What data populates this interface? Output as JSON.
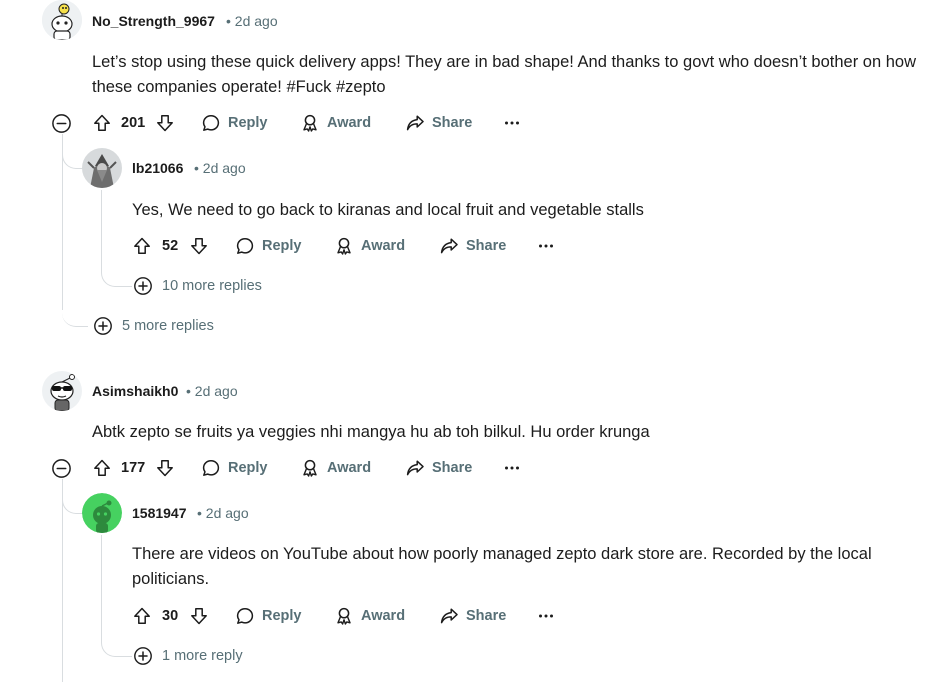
{
  "comments": [
    {
      "username": "No_Strength_9967",
      "age": "2d ago",
      "body": "Let’s stop using these quick delivery apps! They are in bad shape! And thanks to govt who doesn’t bother on how these companies operate! #Fuck #zepto",
      "votes": "201",
      "reply_label": "Reply",
      "award_label": "Award",
      "share_label": "Share",
      "more_label": "•••",
      "replies": [
        {
          "username": "lb21066",
          "age": "2d ago",
          "body": "Yes, We need to go back to kiranas and local fruit and vegetable stalls",
          "votes": "52",
          "reply_label": "Reply",
          "award_label": "Award",
          "share_label": "Share",
          "more_label": "•••",
          "more_replies": "10 more replies"
        }
      ],
      "more_replies": "5 more replies"
    },
    {
      "username": "Asimshaikh0",
      "age": "2d ago",
      "body": "Abtk zepto se fruits ya veggies nhi mangya hu ab toh bilkul. Hu order krunga",
      "votes": "177",
      "reply_label": "Reply",
      "award_label": "Award",
      "share_label": "Share",
      "more_label": "•••",
      "replies": [
        {
          "username": "1581947",
          "age": "2d ago",
          "body": "There are videos on YouTube about how poorly managed zepto dark store are. Recorded by the local politicians.",
          "votes": "30",
          "reply_label": "Reply",
          "award_label": "Award",
          "share_label": "Share",
          "more_label": "•••",
          "more_replies": "1 more reply"
        }
      ]
    }
  ],
  "separator": "•",
  "colors": {
    "text": "#1c1c1c",
    "muted": "#576f76",
    "thread_line": "#d9dde0",
    "avatar_green": "#46d160"
  },
  "icons": {
    "upvote": "upvote-arrow-icon",
    "downvote": "downvote-arrow-icon",
    "reply": "speech-bubble-icon",
    "award": "award-ribbon-icon",
    "share": "share-arrow-icon",
    "collapse": "minus-circle-icon",
    "expand": "plus-circle-icon"
  }
}
